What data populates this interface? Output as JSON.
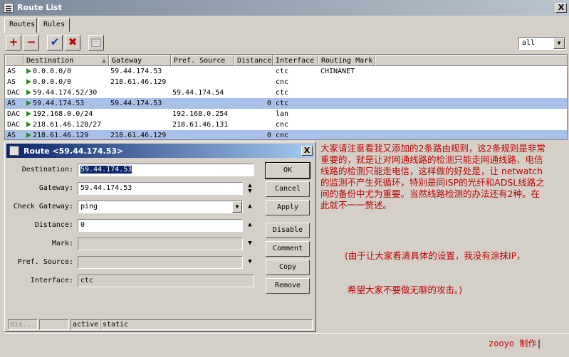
{
  "window": {
    "title": "Route List",
    "close": "X"
  },
  "tabs": [
    {
      "label": "Routes"
    },
    {
      "label": "Rules"
    }
  ],
  "toolbar": {
    "add": "+",
    "remove": "−",
    "enable": "✔",
    "disable": "✖",
    "comment": ""
  },
  "filter": {
    "value": "all"
  },
  "table": {
    "headers": [
      "",
      "Destination",
      "Gateway",
      "Pref. Source",
      "Distance",
      "Interface",
      "Routing Mark"
    ],
    "rows": [
      {
        "flags": "AS",
        "destination": "0.0.0.0/0",
        "gateway": "59.44.174.53",
        "pref_source": "",
        "distance": "",
        "interface": "ctc",
        "routing_mark": "CHINANET",
        "selected": false
      },
      {
        "flags": "AS",
        "destination": "0.0.0.0/0",
        "gateway": "218.61.46.129",
        "pref_source": "",
        "distance": "",
        "interface": "cnc",
        "routing_mark": "",
        "selected": false
      },
      {
        "flags": "DAC",
        "destination": "59.44.174.52/30",
        "gateway": "",
        "pref_source": "59.44.174.54",
        "distance": "",
        "interface": "ctc",
        "routing_mark": "",
        "selected": false
      },
      {
        "flags": "AS",
        "destination": "59.44.174.53",
        "gateway": "59.44.174.53",
        "pref_source": "",
        "distance": "0",
        "interface": "ctc",
        "routing_mark": "",
        "selected": true
      },
      {
        "flags": "DAC",
        "destination": "192.168.0.0/24",
        "gateway": "",
        "pref_source": "192.168.0.254",
        "distance": "",
        "interface": "lan",
        "routing_mark": "",
        "selected": false
      },
      {
        "flags": "DAC",
        "destination": "218.61.46.128/27",
        "gateway": "",
        "pref_source": "218.61.46.131",
        "distance": "",
        "interface": "cnc",
        "routing_mark": "",
        "selected": false
      },
      {
        "flags": "AS",
        "destination": "218.61.46.129",
        "gateway": "218.61.46.129",
        "pref_source": "",
        "distance": "0",
        "interface": "cnc",
        "routing_mark": "",
        "selected": true
      }
    ]
  },
  "dialog": {
    "title": "Route <59.44.174.53>",
    "close": "X",
    "fields": {
      "destination": {
        "label": "Destination:",
        "value": "59.44.174.53"
      },
      "gateway": {
        "label": "Gateway:",
        "value": "59.44.174.53"
      },
      "check_gateway": {
        "label": "Check Gateway:",
        "value": "ping"
      },
      "distance": {
        "label": "Distance:",
        "value": "0"
      },
      "mark": {
        "label": "Mark:",
        "value": ""
      },
      "pref_source": {
        "label": "Pref. Source:",
        "value": ""
      },
      "interface": {
        "label": "Interface:",
        "value": "ctc"
      }
    },
    "buttons": {
      "ok": "OK",
      "cancel": "Cancel",
      "apply": "Apply",
      "disable": "Disable",
      "comment": "Comment",
      "copy": "Copy",
      "remove": "Remove"
    },
    "status": [
      "dis...",
      "",
      "active",
      "static"
    ]
  },
  "note": {
    "lines": [
      "大家请注意看我又添加的2条路由规则，这2条规则是非常",
      "重要的，就是让对网通线路的检测只能走网通线路，电信",
      "线路的检测只能走电信，这样做的好处是，让 netwatch",
      " 的监测不产生死循环，特别是同ISP的光纤和ADSL线路之",
      "间的备份中尤为重要。当然线路检测的办法还有2种。在",
      "此就不一一赘述。"
    ],
    "sub_lines": [
      "(由于让大家看清具体的设置，我没有涂抹IP，",
      " 希望大家不要做无聊的攻击。)"
    ],
    "signature": "zooyo 制作"
  },
  "colors": {
    "selected_row": "#a9c0e8",
    "note_text": "#c00000",
    "dialog_title": "#0a246a"
  }
}
